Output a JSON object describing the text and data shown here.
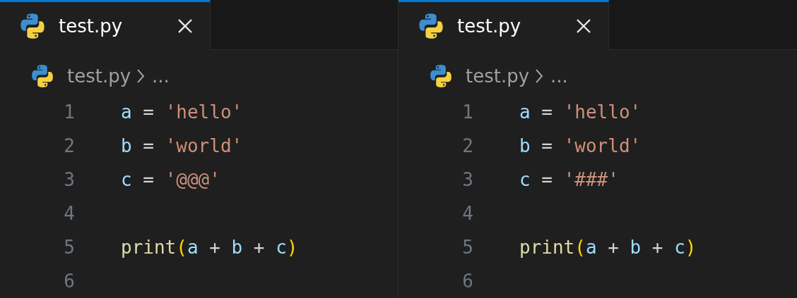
{
  "editors": [
    {
      "tab": {
        "label": "test.py",
        "selected": true
      },
      "breadcrumb": {
        "file": "test.py",
        "more": "..."
      },
      "lines": [
        {
          "number": "1",
          "tokens": [
            {
              "kind": "var",
              "text": "a"
            },
            {
              "kind": "op",
              "text": " = "
            },
            {
              "kind": "str",
              "text": "'hello'"
            }
          ]
        },
        {
          "number": "2",
          "tokens": [
            {
              "kind": "var",
              "text": "b"
            },
            {
              "kind": "op",
              "text": " = "
            },
            {
              "kind": "str",
              "text": "'world'"
            }
          ]
        },
        {
          "number": "3",
          "tokens": [
            {
              "kind": "var",
              "text": "c"
            },
            {
              "kind": "op",
              "text": " = "
            },
            {
              "kind": "str",
              "text": "'@@@'"
            }
          ]
        },
        {
          "number": "4"
        },
        {
          "number": "5",
          "tokens": [
            {
              "kind": "fn",
              "text": "print"
            },
            {
              "kind": "paren",
              "text": "("
            },
            {
              "kind": "var",
              "text": "a"
            },
            {
              "kind": "op",
              "text": " + "
            },
            {
              "kind": "var",
              "text": "b"
            },
            {
              "kind": "op",
              "text": " + "
            },
            {
              "kind": "var",
              "text": "c"
            },
            {
              "kind": "paren",
              "text": ")"
            }
          ]
        },
        {
          "number": "6"
        }
      ]
    },
    {
      "tab": {
        "label": "test.py",
        "selected": true
      },
      "breadcrumb": {
        "file": "test.py",
        "more": "..."
      },
      "lines": [
        {
          "number": "1",
          "tokens": [
            {
              "kind": "var",
              "text": "a"
            },
            {
              "kind": "op",
              "text": " = "
            },
            {
              "kind": "str",
              "text": "'hello'"
            }
          ]
        },
        {
          "number": "2",
          "tokens": [
            {
              "kind": "var",
              "text": "b"
            },
            {
              "kind": "op",
              "text": " = "
            },
            {
              "kind": "str",
              "text": "'world'"
            }
          ]
        },
        {
          "number": "3",
          "tokens": [
            {
              "kind": "var",
              "text": "c"
            },
            {
              "kind": "op",
              "text": " = "
            },
            {
              "kind": "str",
              "text": "'###'"
            }
          ]
        },
        {
          "number": "4"
        },
        {
          "number": "5",
          "tokens": [
            {
              "kind": "fn",
              "text": "print"
            },
            {
              "kind": "paren",
              "text": "("
            },
            {
              "kind": "var",
              "text": "a"
            },
            {
              "kind": "op",
              "text": " + "
            },
            {
              "kind": "var",
              "text": "b"
            },
            {
              "kind": "op",
              "text": " + "
            },
            {
              "kind": "var",
              "text": "c"
            },
            {
              "kind": "paren",
              "text": ")"
            }
          ]
        },
        {
          "number": "6"
        }
      ]
    }
  ]
}
